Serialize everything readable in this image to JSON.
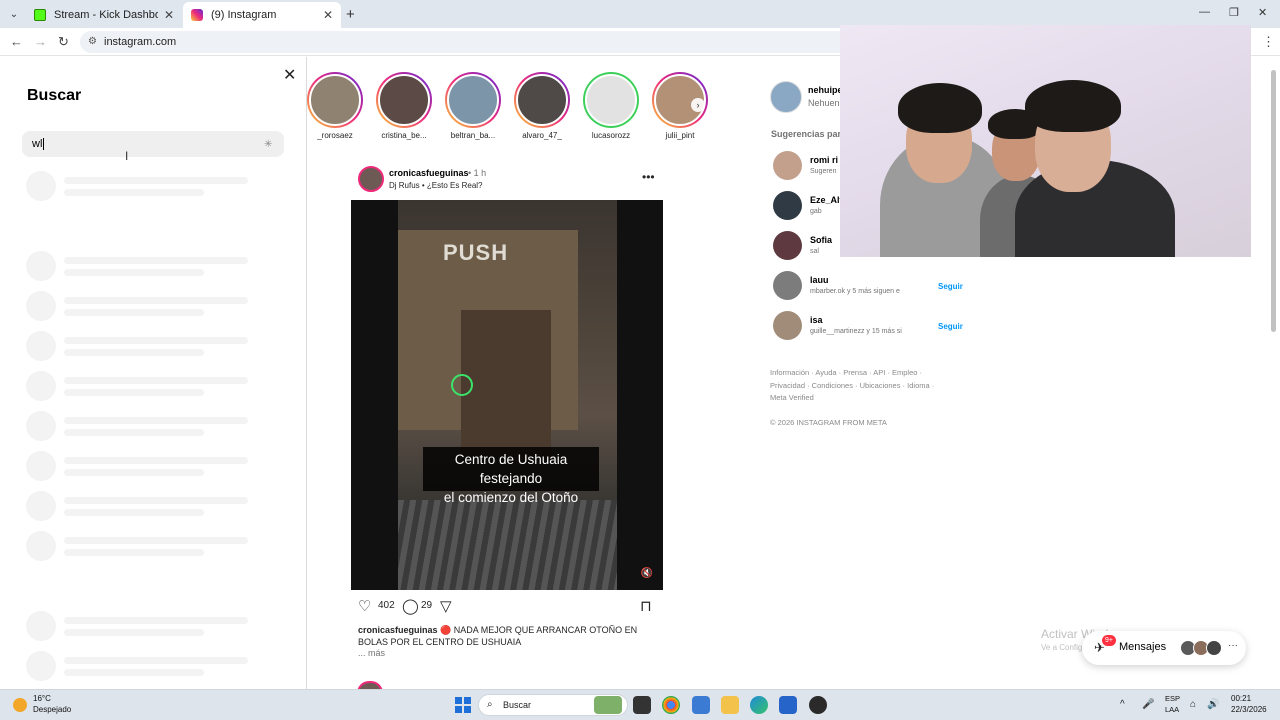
{
  "browser": {
    "tabs": [
      {
        "title": "Stream - Kick Dashboard",
        "favicon": "kick-icon"
      },
      {
        "title": "(9) Instagram",
        "favicon": "instagram-icon"
      }
    ],
    "url": "instagram.com"
  },
  "search": {
    "title": "Buscar",
    "query": "wl"
  },
  "stories": [
    {
      "name": "_rorosaez",
      "ring": "gradient"
    },
    {
      "name": "cristina_be...",
      "ring": "gradient"
    },
    {
      "name": "beltran_ba...",
      "ring": "gradient"
    },
    {
      "name": "alvaro_47_",
      "ring": "gradient"
    },
    {
      "name": "lucasorozz",
      "ring": "close-friends"
    },
    {
      "name": "julii_pint",
      "ring": "gradient"
    }
  ],
  "post": {
    "username": "cronicasfueguinas",
    "time": "1 h",
    "audio": "Dj Rufus • ¿Esto Es Real?",
    "video_caption_line1": "Centro de Ushuaia festejando",
    "video_caption_line2": "el comienzo del Otoño",
    "video_sign": "PUSH",
    "likes": "402",
    "comments": "29",
    "caption_user": "cronicasfueguinas",
    "caption_text": "🔴 NADA MEJOR QUE ARRANCAR OTOÑO EN BOLAS POR EL CENTRO DE USHUAIA",
    "more": "... más"
  },
  "sidebar": {
    "me_user": "nehuipe",
    "me_name": "Nehuen",
    "suggestions_title": "Sugerencias para",
    "suggestions": [
      {
        "user": "romi ri",
        "sub": "Sugeren",
        "follow": ""
      },
      {
        "user": "Eze_Alf",
        "sub": "gab",
        "follow": ""
      },
      {
        "user": "Sofia",
        "sub": "sal",
        "follow": ""
      },
      {
        "user": "lauu",
        "sub": "mbarber.ok y 5 más siguen e",
        "follow": "Seguir"
      },
      {
        "user": "isa",
        "sub": "guille__martinezz y 15 más si",
        "follow": "Seguir"
      }
    ],
    "footer_links": "Información · Ayuda · Prensa · API · Empleo · Privacidad · Condiciones · Ubicaciones · Idioma · Meta Verified",
    "copyright": "© 2026 INSTAGRAM FROM META"
  },
  "messages": {
    "label": "Mensajes",
    "badge": "9+"
  },
  "watermark": {
    "line1": "Activar Windows",
    "line2": "Ve a Configuración para activar Windows."
  },
  "taskbar": {
    "temp": "16°C",
    "weather": "Despejado",
    "search_placeholder": "Buscar",
    "lang1": "ESP",
    "lang2": "LAA",
    "time": "00:21",
    "date": "22/3/2026"
  },
  "colors": {
    "accent": "#0095f6",
    "badge": "#ff3040",
    "story_ring_close": "#3ccf5a"
  }
}
